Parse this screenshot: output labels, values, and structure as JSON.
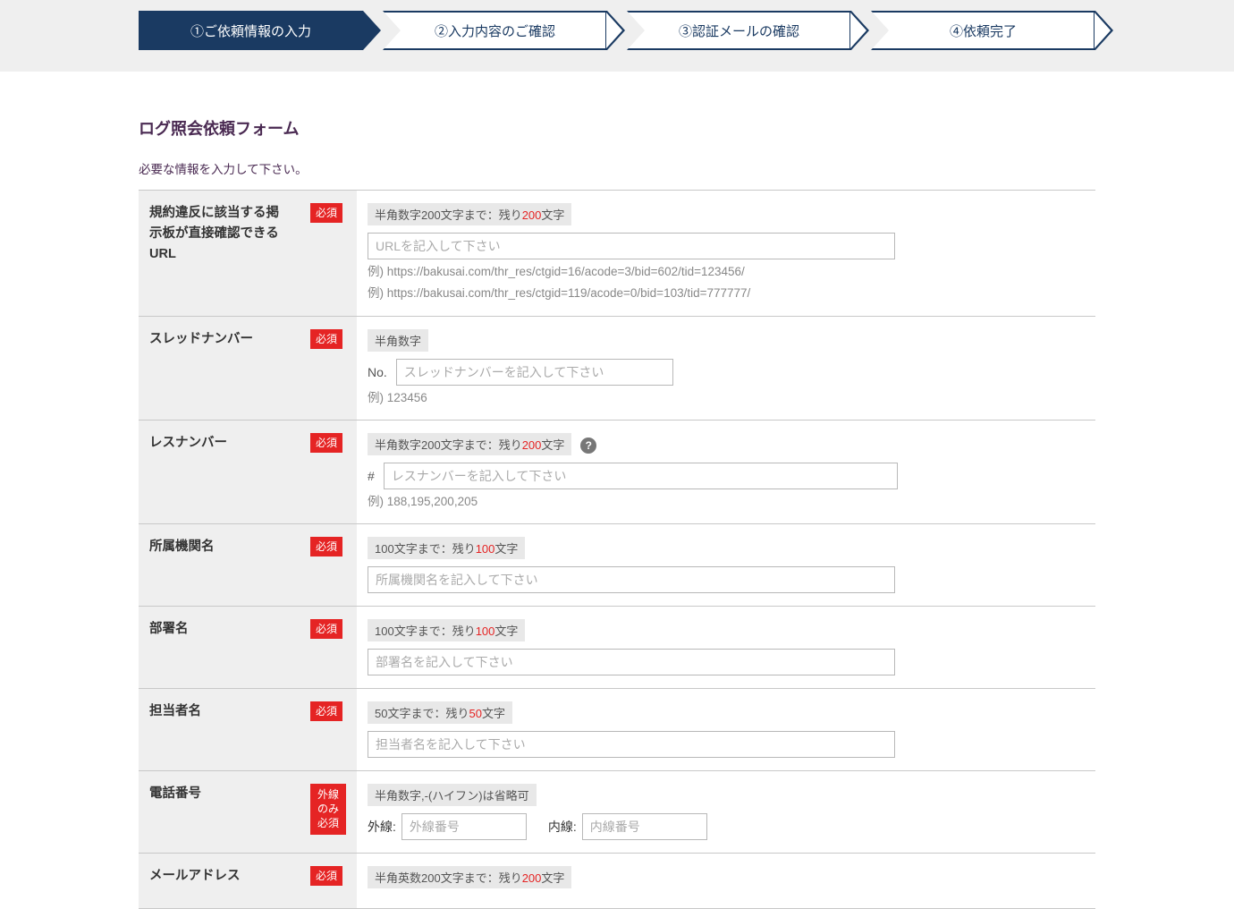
{
  "stepper": {
    "steps": [
      {
        "label": "①ご依頼情報の入力",
        "active": true
      },
      {
        "label": "②入力内容のご確認",
        "active": false
      },
      {
        "label": "③認証メールの確認",
        "active": false
      },
      {
        "label": "④依頼完了",
        "active": false
      }
    ]
  },
  "page": {
    "title": "ログ照会依頼フォーム",
    "instruction": "必要な情報を入力して下さい。"
  },
  "badges": {
    "required": "必須",
    "phone_required": "外線\nのみ\n必須"
  },
  "fields": {
    "url": {
      "label": "規約違反に該当する掲示板が直接確認できるURL",
      "hint_prefix": "半角数字200文字まで：残り",
      "hint_count": "200",
      "hint_suffix": "文字",
      "placeholder": "URLを記入して下さい",
      "ex1": "例) https://bakusai.com/thr_res/ctgid=16/acode=3/bid=602/tid=123456/",
      "ex2": "例) https://bakusai.com/thr_res/ctgid=119/acode=0/bid=103/tid=777777/"
    },
    "thread": {
      "label": "スレッドナンバー",
      "hint": "半角数字",
      "prefix": "No.",
      "placeholder": "スレッドナンバーを記入して下さい",
      "ex": "例) 123456"
    },
    "res": {
      "label": "レスナンバー",
      "hint_prefix": "半角数字200文字まで：残り",
      "hint_count": "200",
      "hint_suffix": "文字",
      "prefix": "#",
      "placeholder": "レスナンバーを記入して下さい",
      "ex": "例) 188,195,200,205"
    },
    "org": {
      "label": "所属機関名",
      "hint_prefix": "100文字まで：残り",
      "hint_count": "100",
      "hint_suffix": "文字",
      "placeholder": "所属機関名を記入して下さい"
    },
    "dept": {
      "label": "部署名",
      "hint_prefix": "100文字まで：残り",
      "hint_count": "100",
      "hint_suffix": "文字",
      "placeholder": "部署名を記入して下さい"
    },
    "person": {
      "label": "担当者名",
      "hint_prefix": "50文字まで：残り",
      "hint_count": "50",
      "hint_suffix": "文字",
      "placeholder": "担当者名を記入して下さい"
    },
    "phone": {
      "label": "電話番号",
      "hint": "半角数字,-(ハイフン)は省略可",
      "ext_label": "外線:",
      "ext_placeholder": "外線番号",
      "int_label": "内線:",
      "int_placeholder": "内線番号"
    },
    "email": {
      "label": "メールアドレス",
      "hint_prefix": "半角英数200文字まで：残り",
      "hint_count": "200",
      "hint_suffix": "文字"
    }
  }
}
